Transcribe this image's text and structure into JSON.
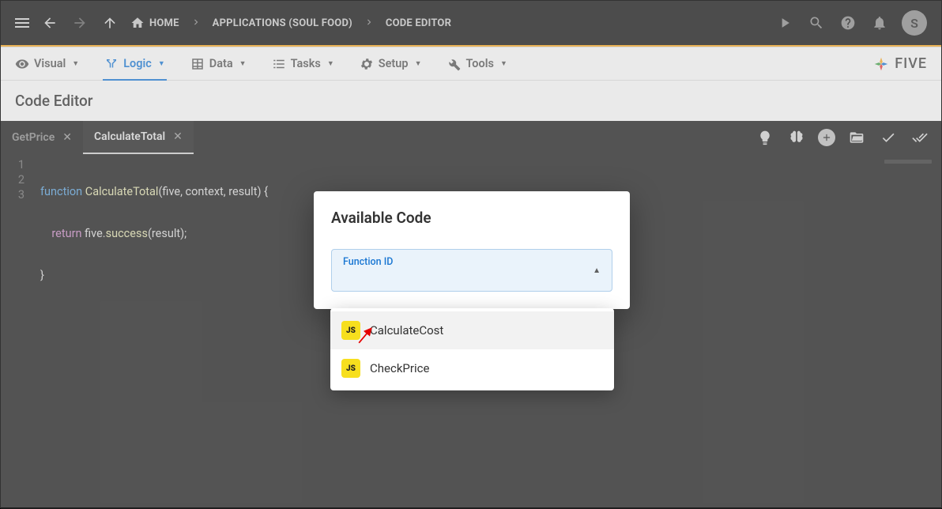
{
  "topNav": {
    "home": "HOME",
    "applications": "APPLICATIONS (SOUL FOOD)",
    "codeEditor": "CODE EDITOR",
    "avatarLetter": "S"
  },
  "menu": {
    "visual": "Visual",
    "logic": "Logic",
    "data": "Data",
    "tasks": "Tasks",
    "setup": "Setup",
    "tools": "Tools",
    "brand": "FIVE"
  },
  "subHeader": "Code Editor",
  "tabs": {
    "t1": "GetPrice",
    "t2": "CalculateTotal"
  },
  "code": {
    "line1_kw": "function",
    "line1_fn": "CalculateTotal",
    "line1_rest": "(five, context, result) {",
    "line2_indent": "    ",
    "line2_ret": "return",
    "line2_obj": " five.",
    "line2_call": "success",
    "line2_arg": "(result);",
    "line3": "}"
  },
  "gutter": {
    "l1": "1",
    "l2": "2",
    "l3": "3"
  },
  "dialog": {
    "title": "Available Code",
    "fieldLabel": "Function ID"
  },
  "dropdown": {
    "badge": "JS",
    "item1": "CalculateCost",
    "item2": "CheckPrice"
  }
}
